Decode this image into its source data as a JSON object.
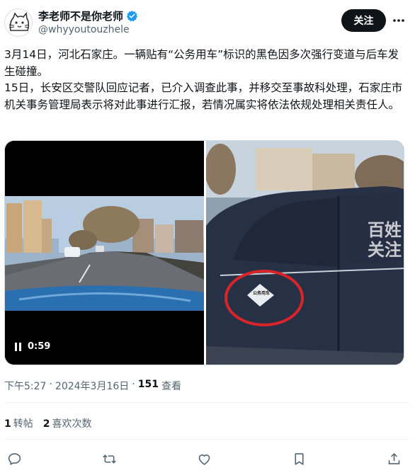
{
  "author": {
    "display_name": "李老师不是你老师",
    "handle": "@whyyoutouzhele",
    "verified_badge_icon": "verified-badge-icon",
    "avatar_icon": "cat-sketch-avatar"
  },
  "header": {
    "follow_label": "关注",
    "more_icon": "more-dots-icon"
  },
  "tweet": {
    "paragraph_1": "3月14日，河北石家庄。一辆贴有“公务用车”标识的黑色因多次强行变道与后车发生碰撞。",
    "paragraph_2": "15日，长安区交警队回应记者，已介入调查此事，并移交至事故科处理，石家庄市机关事务管理局表示将对此事进行汇报，若情况属实将依法依规处理相关责任人。"
  },
  "media": {
    "video_duration": "0:59",
    "right_overlay_text_1": "百姓",
    "right_overlay_text_2": "关注",
    "sticker_text": "公务用车"
  },
  "meta": {
    "time": "下午5:27",
    "sep1": "·",
    "date": "2024年3月16日",
    "sep2": "·",
    "views_count": "151",
    "views_label": "查看"
  },
  "stats": {
    "retweets_count": "1",
    "retweets_label": "转帖",
    "likes_count": "2",
    "likes_label": "喜欢次数"
  },
  "colors": {
    "text_primary": "#0f1419",
    "text_secondary": "#536471",
    "verified_blue": "#1d9bf0",
    "divider": "#eff3f4"
  }
}
